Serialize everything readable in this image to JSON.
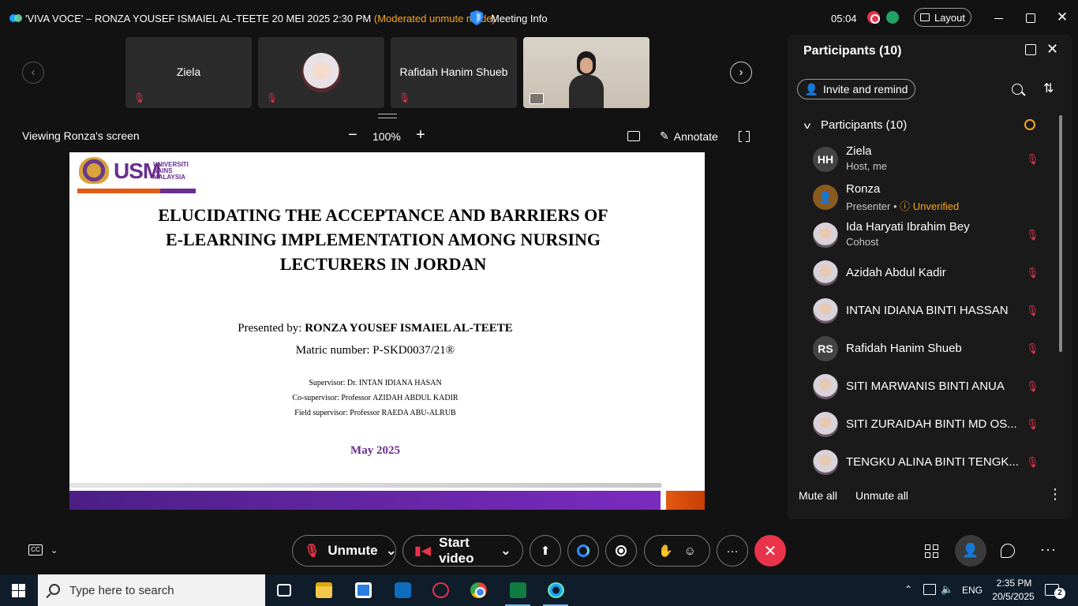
{
  "titlebar": {
    "meeting_title": "'VIVA VOCE' – RONZA YOUSEF ISMAIEL AL-TEETE 20 MEI 2025 2:30 PM",
    "mode": "(Moderated unmute mode)",
    "meeting_info": "Meeting Info",
    "clock": "05:04",
    "layout_label": "Layout"
  },
  "video_strip": {
    "tiles": [
      {
        "name": "Ziela",
        "muted": true
      },
      {
        "name": "",
        "muted": true
      },
      {
        "name": "Rafidah Hanim Shueb",
        "muted": true
      }
    ]
  },
  "share": {
    "viewing": "Viewing Ronza's screen",
    "zoom": "100%",
    "annotate": "Annotate"
  },
  "slide": {
    "university_abbr": "USM",
    "university_small": [
      "UNIVERSITI",
      "SAINS",
      "MALAYSIA"
    ],
    "title_lines": [
      "ELUCIDATING THE ACCEPTANCE AND BARRIERS OF",
      "E-LEARNING IMPLEMENTATION AMONG NURSING",
      "LECTURERS IN JORDAN"
    ],
    "presented_label": "Presented by: ",
    "presenter": "RONZA YOUSEF ISMAIEL AL-TEETE",
    "matric": "Matric number: P-SKD0037/21®",
    "supervisor": "Supervisor: Dr. INTAN  IDIANA HASAN",
    "co_supervisor": "Co-supervisor: Professor  AZIDAH   ABDUL KADIR",
    "field_supervisor": "Field supervisor:  Professor RAEDA ABU-ALRUB",
    "date": "May 2025"
  },
  "participants_panel": {
    "title": "Participants (10)",
    "invite_label": "Invite and remind",
    "group_label": "Participants (10)",
    "mute_all": "Mute all",
    "unmute_all": "Unmute all",
    "list": [
      {
        "initials": "HH",
        "name": "Ziela",
        "sub": "Host, me",
        "avatar": "initials",
        "muted": true
      },
      {
        "initials": "",
        "name": "Ronza",
        "sub": "Presenter • ",
        "unverified": "Unverified",
        "avatar": "ronza",
        "muted": false
      },
      {
        "initials": "",
        "name": "Ida Haryati Ibrahim Bey",
        "sub": "Cohost",
        "avatar": "photo",
        "muted": true
      },
      {
        "initials": "",
        "name": "Azidah Abdul Kadir",
        "sub": "",
        "avatar": "photo",
        "muted": true
      },
      {
        "initials": "",
        "name": "INTAN IDIANA BINTI HASSAN",
        "sub": "",
        "avatar": "photo",
        "muted": true
      },
      {
        "initials": "RS",
        "name": "Rafidah Hanim Shueb",
        "sub": "",
        "avatar": "initials",
        "muted": true
      },
      {
        "initials": "",
        "name": "SITI MARWANIS BINTI ANUA",
        "sub": "",
        "avatar": "photo",
        "muted": true
      },
      {
        "initials": "",
        "name": "SITI ZURAIDAH BINTI MD OS...",
        "sub": "",
        "avatar": "photo",
        "muted": true
      },
      {
        "initials": "",
        "name": "TENGKU ALINA BINTI TENGK...",
        "sub": "",
        "avatar": "photo",
        "muted": true
      }
    ]
  },
  "controls": {
    "unmute": "Unmute",
    "start_video": "Start video"
  },
  "taskbar": {
    "search_placeholder": "Type here to search",
    "language": "ENG",
    "time": "2:35 PM",
    "date": "20/5/2025",
    "notifications": "2"
  }
}
